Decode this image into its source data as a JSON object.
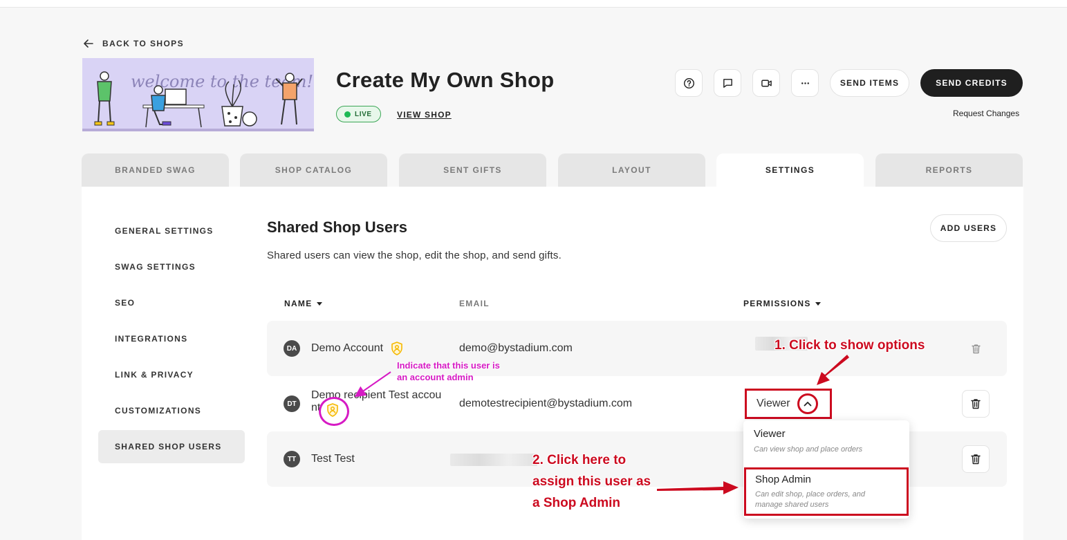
{
  "nav": {
    "back_label": "BACK TO SHOPS"
  },
  "banner": {
    "text": "welcome to the team!"
  },
  "shop": {
    "title": "Create My Own Shop",
    "status": "LIVE",
    "view_link": "VIEW SHOP"
  },
  "actions": {
    "icons": [
      "help-icon",
      "chat-icon",
      "video-icon",
      "more-icon"
    ],
    "send_items": "SEND ITEMS",
    "send_credits": "SEND CREDITS",
    "request_changes": "Request Changes"
  },
  "tabs": [
    {
      "label": "BRANDED SWAG"
    },
    {
      "label": "SHOP CATALOG"
    },
    {
      "label": "SENT GIFTS"
    },
    {
      "label": "LAYOUT"
    },
    {
      "label": "SETTINGS",
      "active": true
    },
    {
      "label": "REPORTS"
    }
  ],
  "sidebar": {
    "items": [
      {
        "label": "GENERAL SETTINGS"
      },
      {
        "label": "SWAG SETTINGS"
      },
      {
        "label": "SEO"
      },
      {
        "label": "INTEGRATIONS"
      },
      {
        "label": "LINK & PRIVACY"
      },
      {
        "label": "CUSTOMIZATIONS"
      },
      {
        "label": "SHARED SHOP USERS",
        "active": true
      }
    ]
  },
  "section": {
    "title": "Shared Shop Users",
    "description": "Shared users can view the shop, edit the shop, and send gifts.",
    "add_button": "ADD USERS"
  },
  "table": {
    "headers": {
      "name": "NAME",
      "email": "EMAIL",
      "permissions": "PERMISSIONS"
    },
    "rows": [
      {
        "initials": "DA",
        "name": "Demo Account",
        "email": "demo@bystadium.com",
        "admin": true
      },
      {
        "initials": "DT",
        "name_line1": "Demo recipient Test accou",
        "name_line2": "nt",
        "email": "demotestrecipient@bystadium.com",
        "permission": "Viewer",
        "admin": true
      },
      {
        "initials": "TT",
        "name": "Test Test",
        "email": ""
      }
    ]
  },
  "dropdown": {
    "options": [
      {
        "title": "Viewer",
        "desc": "Can view shop and place orders"
      },
      {
        "title": "Shop Admin",
        "desc_line1": "Can edit shop, place orders, and",
        "desc_line2": "manage shared users"
      }
    ]
  },
  "annotations": {
    "step1": "1. Click to show options",
    "step2_line1": "2. Click here to",
    "step2_line2": "assign this user as",
    "step2_line3": "a Shop Admin",
    "admin_note_line1": "Indicate that this user is",
    "admin_note_line2": "an account admin",
    "colors": {
      "red": "#cc0a1f",
      "magenta": "#d61ac4"
    }
  },
  "colors": {
    "accent_dark": "#1f1f1f",
    "live_green": "#1db954",
    "admin_gold": "#f5b800"
  }
}
